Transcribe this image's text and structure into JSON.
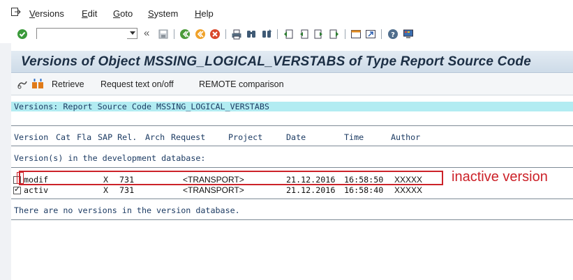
{
  "menubar": {
    "items": [
      "Versions",
      "Edit",
      "Goto",
      "System",
      "Help"
    ]
  },
  "toolbar": {
    "command_value": "",
    "icons": [
      "enter-icon",
      "back-icon",
      "save-icon",
      "back-green-icon",
      "exit-icon",
      "cancel-icon",
      "print-icon",
      "find-icon",
      "find-next-icon",
      "first-page-icon",
      "prev-page-icon",
      "next-page-icon",
      "last-page-icon",
      "create-session-icon",
      "shortcut-icon",
      "help-icon",
      "customize-layout-icon"
    ]
  },
  "title": "Versions of Object MSSING_LOGICAL_VERSTABS of Type Report Source Code",
  "app_toolbar": {
    "retrieve": "Retrieve",
    "request_text": "Request text on/off",
    "remote_comparison": "REMOTE comparison"
  },
  "list": {
    "header": "Versions: Report Source Code MSSING_LOGICAL_VERSTABS",
    "columns": [
      "Version",
      "Cat",
      "Fla",
      "SAP Rel.",
      "Arch",
      "Request",
      "Project",
      "Date",
      "Time",
      "Author"
    ],
    "dev_db_label": "Version(s) in the development database:",
    "rows": [
      {
        "checked": false,
        "version": "modif",
        "flag": "X",
        "rel": "731",
        "request": "<TRANSPORT>",
        "date": "21.12.2016",
        "time": "16:58:50",
        "author": "XXXXX"
      },
      {
        "checked": true,
        "version": "activ",
        "flag": "X",
        "rel": "731",
        "request": "<TRANSPORT>",
        "date": "21.12.2016",
        "time": "16:58:40",
        "author": "XXXXX"
      }
    ],
    "no_versions": "There are no versions in the version database."
  },
  "annotation": {
    "label": "inactive version",
    "color": "#cc2229"
  }
}
